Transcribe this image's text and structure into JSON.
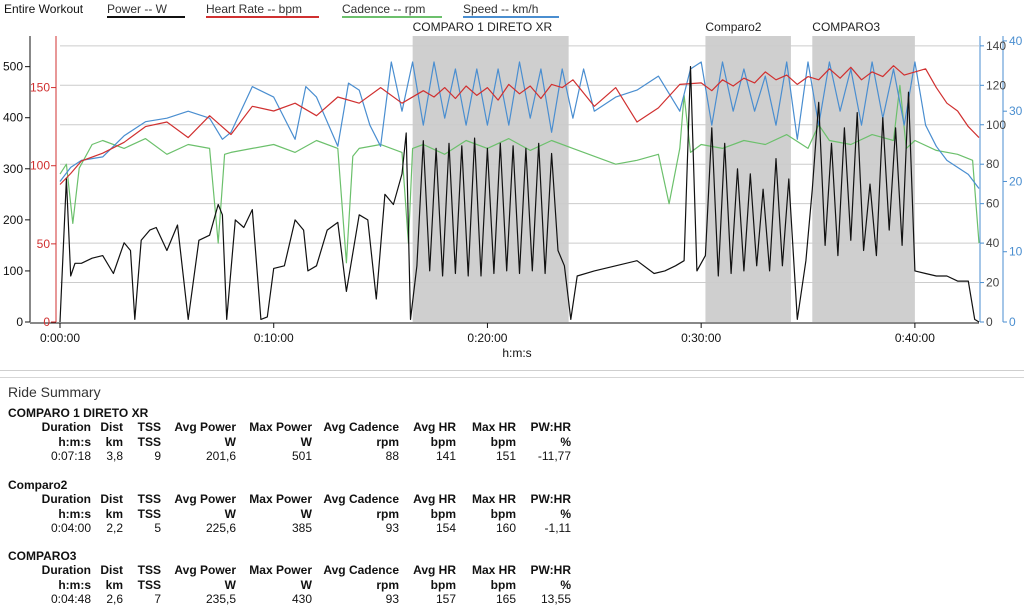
{
  "chart": {
    "legend": {
      "title": "Entire Workout",
      "items": [
        {
          "label": "Power  -- W",
          "color": "#111111"
        },
        {
          "label": "Heart Rate  -- bpm",
          "color": "#d03030"
        },
        {
          "label": "Cadence  -- rpm",
          "color": "#6cc06c"
        },
        {
          "label": "Speed  -- km/h",
          "color": "#4a8ed0"
        }
      ]
    },
    "x_label": "h:m:s"
  },
  "chart_data": {
    "type": "line",
    "x_ticks": [
      "0:00:00",
      "0:10:00",
      "0:20:00",
      "0:30:00",
      "0:40:00"
    ],
    "x_range_min": [
      0,
      43
    ],
    "y_axes": {
      "power": {
        "ticks": [
          0,
          100,
          200,
          300,
          400,
          500
        ],
        "range": [
          0,
          560
        ],
        "color": "#111111"
      },
      "heart_rate": {
        "ticks": [
          0,
          50,
          100,
          150
        ],
        "range": [
          0,
          183
        ],
        "color": "#d03030"
      },
      "cadence": {
        "ticks": [
          0,
          20,
          40,
          60,
          80,
          100,
          120,
          140
        ],
        "range": [
          0,
          145
        ],
        "color": "#555555"
      },
      "speed": {
        "ticks": [
          0,
          10,
          20,
          30,
          40
        ],
        "range": [
          0,
          40.7
        ],
        "color": "#4a8ed0"
      }
    },
    "highlighted_ranges": [
      {
        "label": "COMPARO 1 DIRETO XR",
        "start_min": 16.5,
        "end_min": 23.8
      },
      {
        "label": "Comparo2",
        "start_min": 30.2,
        "end_min": 34.2
      },
      {
        "label": "COMPARO3",
        "start_min": 35.2,
        "end_min": 40.0
      }
    ],
    "series": [
      {
        "name": "Power",
        "unit": "W",
        "axis": "power",
        "color": "#111111",
        "x_min": [
          0,
          0.3,
          0.5,
          0.7,
          1.0,
          1.5,
          2.0,
          2.5,
          3.0,
          3.3,
          3.5,
          3.8,
          4.2,
          4.5,
          5.0,
          5.5,
          6.0,
          6.5,
          7.0,
          7.4,
          7.6,
          7.8,
          8.2,
          8.6,
          9.0,
          9.4,
          9.7,
          10.0,
          10.5,
          11.0,
          11.4,
          11.6,
          12.0,
          12.5,
          13.0,
          13.4,
          13.6,
          14.0,
          14.4,
          14.8,
          15.2,
          15.6,
          16.0,
          16.2,
          16.4,
          16.7,
          17.0,
          17.3,
          17.6,
          17.9,
          18.2,
          18.5,
          18.8,
          19.1,
          19.4,
          19.7,
          20.0,
          20.3,
          20.6,
          20.9,
          21.2,
          21.5,
          21.8,
          22.1,
          22.4,
          22.7,
          23.0,
          23.3,
          23.6,
          23.9,
          24.2,
          25.0,
          26.0,
          27.0,
          27.8,
          28.3,
          28.8,
          29.2,
          29.5,
          29.8,
          30.2,
          30.5,
          30.8,
          31.1,
          31.4,
          31.7,
          32.0,
          32.3,
          32.6,
          32.9,
          33.2,
          33.5,
          33.8,
          34.1,
          34.5,
          34.9,
          35.2,
          35.5,
          35.8,
          36.1,
          36.4,
          36.7,
          37.0,
          37.3,
          37.6,
          37.9,
          38.2,
          38.5,
          38.8,
          39.1,
          39.4,
          39.7,
          40.0,
          40.5,
          41.0,
          41.5,
          42.0,
          42.5,
          42.8,
          43.0
        ],
        "values": [
          0,
          280,
          90,
          115,
          115,
          125,
          130,
          95,
          155,
          140,
          5,
          160,
          180,
          185,
          140,
          190,
          5,
          160,
          170,
          230,
          210,
          5,
          200,
          185,
          220,
          5,
          10,
          105,
          110,
          200,
          180,
          100,
          110,
          180,
          195,
          60,
          110,
          210,
          200,
          45,
          250,
          230,
          290,
          370,
          5,
          110,
          355,
          100,
          340,
          90,
          350,
          95,
          345,
          90,
          360,
          90,
          340,
          95,
          350,
          100,
          345,
          95,
          340,
          100,
          350,
          95,
          330,
          140,
          110,
          5,
          90,
          100,
          110,
          120,
          95,
          100,
          110,
          120,
          500,
          100,
          130,
          380,
          90,
          350,
          95,
          300,
          100,
          290,
          110,
          260,
          100,
          320,
          110,
          280,
          5,
          120,
          260,
          430,
          150,
          350,
          130,
          380,
          160,
          410,
          140,
          270,
          130,
          400,
          180,
          380,
          150,
          450,
          100,
          95,
          90,
          90,
          80,
          80,
          5,
          0
        ]
      },
      {
        "name": "Heart Rate",
        "unit": "bpm",
        "axis": "heart_rate",
        "color": "#d03030",
        "x_min": [
          0,
          0.5,
          1.0,
          2.0,
          3.0,
          4.0,
          5.0,
          6.0,
          7.0,
          8.0,
          9.0,
          10.0,
          11.0,
          12.0,
          13.0,
          14.0,
          15.0,
          16.0,
          17.0,
          17.5,
          18.0,
          18.5,
          19.0,
          19.5,
          20.0,
          20.5,
          21.0,
          21.5,
          22.0,
          22.5,
          23.0,
          23.5,
          24.0,
          25.0,
          26.0,
          27.0,
          28.0,
          29.0,
          30.0,
          30.5,
          31.0,
          31.5,
          32.0,
          32.5,
          33.0,
          33.5,
          34.0,
          34.5,
          35.0,
          35.5,
          36.0,
          36.5,
          37.0,
          37.5,
          38.0,
          38.5,
          39.0,
          39.5,
          40.0,
          40.5,
          41.0,
          41.5,
          42.0,
          42.5,
          43.0
        ],
        "values": [
          88,
          95,
          103,
          108,
          115,
          125,
          128,
          118,
          132,
          120,
          138,
          135,
          140,
          132,
          144,
          140,
          150,
          140,
          148,
          144,
          150,
          143,
          151,
          145,
          150,
          142,
          152,
          146,
          151,
          143,
          152,
          150,
          155,
          138,
          150,
          128,
          137,
          152,
          153,
          148,
          155,
          151,
          156,
          153,
          160,
          155,
          158,
          152,
          157,
          155,
          162,
          156,
          163,
          155,
          160,
          157,
          164,
          158,
          160,
          162,
          150,
          140,
          135,
          125,
          118
        ]
      },
      {
        "name": "Cadence",
        "unit": "rpm",
        "axis": "cadence",
        "color": "#6cc06c",
        "x_min": [
          0,
          0.3,
          0.6,
          0.9,
          1.5,
          2.0,
          3.0,
          4.0,
          5.0,
          6.0,
          7.0,
          7.4,
          7.7,
          8.0,
          9.0,
          10.0,
          11.0,
          12.0,
          13.0,
          13.4,
          13.7,
          14.0,
          15.0,
          16.0,
          16.3,
          16.5,
          17.0,
          18.0,
          19.0,
          20.0,
          21.0,
          22.0,
          23.0,
          24.0,
          25.0,
          26.0,
          27.0,
          28.0,
          28.5,
          29.0,
          29.2,
          29.5,
          30.0,
          31.0,
          32.0,
          33.0,
          34.0,
          35.0,
          35.5,
          36.0,
          37.0,
          38.0,
          39.0,
          39.3,
          39.6,
          40.0,
          41.0,
          42.0,
          42.7,
          43.0
        ],
        "values": [
          75,
          80,
          50,
          78,
          90,
          92,
          88,
          93,
          85,
          90,
          88,
          40,
          85,
          86,
          88,
          90,
          86,
          92,
          88,
          30,
          84,
          88,
          90,
          86,
          40,
          88,
          90,
          85,
          92,
          88,
          93,
          87,
          92,
          88,
          84,
          80,
          82,
          85,
          60,
          88,
          115,
          86,
          90,
          88,
          92,
          90,
          95,
          88,
          100,
          92,
          90,
          95,
          92,
          120,
          88,
          92,
          87,
          85,
          82,
          40
        ]
      },
      {
        "name": "Speed",
        "unit": "km/h",
        "axis": "speed",
        "color": "#4a8ed0",
        "x_min": [
          0,
          0.5,
          1.0,
          2.0,
          3.0,
          4.0,
          5.0,
          6.0,
          7.0,
          7.6,
          8.0,
          9.0,
          10.0,
          11.0,
          11.5,
          12.0,
          13.0,
          13.5,
          14.0,
          14.5,
          15.0,
          15.5,
          16.0,
          16.5,
          17.0,
          17.5,
          18.0,
          18.5,
          19.0,
          19.5,
          20.0,
          20.5,
          21.0,
          21.5,
          22.0,
          22.5,
          23.0,
          23.5,
          24.0,
          24.5,
          25.0,
          26.0,
          27.0,
          28.0,
          29.0,
          29.5,
          30.0,
          30.5,
          31.0,
          31.5,
          32.0,
          32.5,
          33.0,
          33.5,
          34.0,
          34.5,
          35.0,
          35.5,
          36.0,
          36.5,
          37.0,
          37.5,
          38.0,
          38.5,
          39.0,
          39.5,
          40.0,
          40.5,
          41.0,
          41.5,
          42.0,
          42.5,
          43.0
        ],
        "values": [
          20,
          22,
          23,
          23.5,
          26.5,
          28.5,
          29,
          30,
          29,
          26,
          27,
          33.5,
          32,
          26,
          33.5,
          32,
          25,
          34,
          33,
          28,
          25,
          37,
          30,
          37,
          28,
          37,
          29,
          36,
          28,
          36,
          28,
          36,
          28,
          37,
          29,
          36,
          27,
          36,
          29,
          36,
          30,
          32,
          33,
          35,
          30,
          36,
          37,
          28,
          37,
          30,
          36,
          30,
          35,
          28,
          37,
          26,
          37,
          28,
          37,
          30,
          36,
          28,
          37,
          29,
          36,
          28,
          37,
          28,
          25,
          23,
          22,
          21,
          19
        ]
      }
    ]
  },
  "summary": {
    "title": "Ride Summary",
    "columns": [
      {
        "h1": "Duration",
        "h2": "h:m:s"
      },
      {
        "h1": "Dist",
        "h2": "km"
      },
      {
        "h1": "TSS",
        "h2": "TSS"
      },
      {
        "h1": "Avg Power",
        "h2": "W"
      },
      {
        "h1": "Max Power",
        "h2": "W"
      },
      {
        "h1": "Avg Cadence",
        "h2": "rpm"
      },
      {
        "h1": "Avg HR",
        "h2": "bpm"
      },
      {
        "h1": "Max HR",
        "h2": "bpm"
      },
      {
        "h1": "PW:HR",
        "h2": "%"
      }
    ],
    "sections": [
      {
        "name": "COMPARO 1 DIRETO XR",
        "values": [
          "0:07:18",
          "3,8",
          "9",
          "201,6",
          "501",
          "88",
          "141",
          "151",
          "-11,77"
        ]
      },
      {
        "name": "Comparo2",
        "values": [
          "0:04:00",
          "2,2",
          "5",
          "225,6",
          "385",
          "93",
          "154",
          "160",
          "-1,11"
        ]
      },
      {
        "name": "COMPARO3",
        "values": [
          "0:04:48",
          "2,6",
          "7",
          "235,5",
          "430",
          "93",
          "157",
          "165",
          "13,55"
        ]
      }
    ]
  }
}
